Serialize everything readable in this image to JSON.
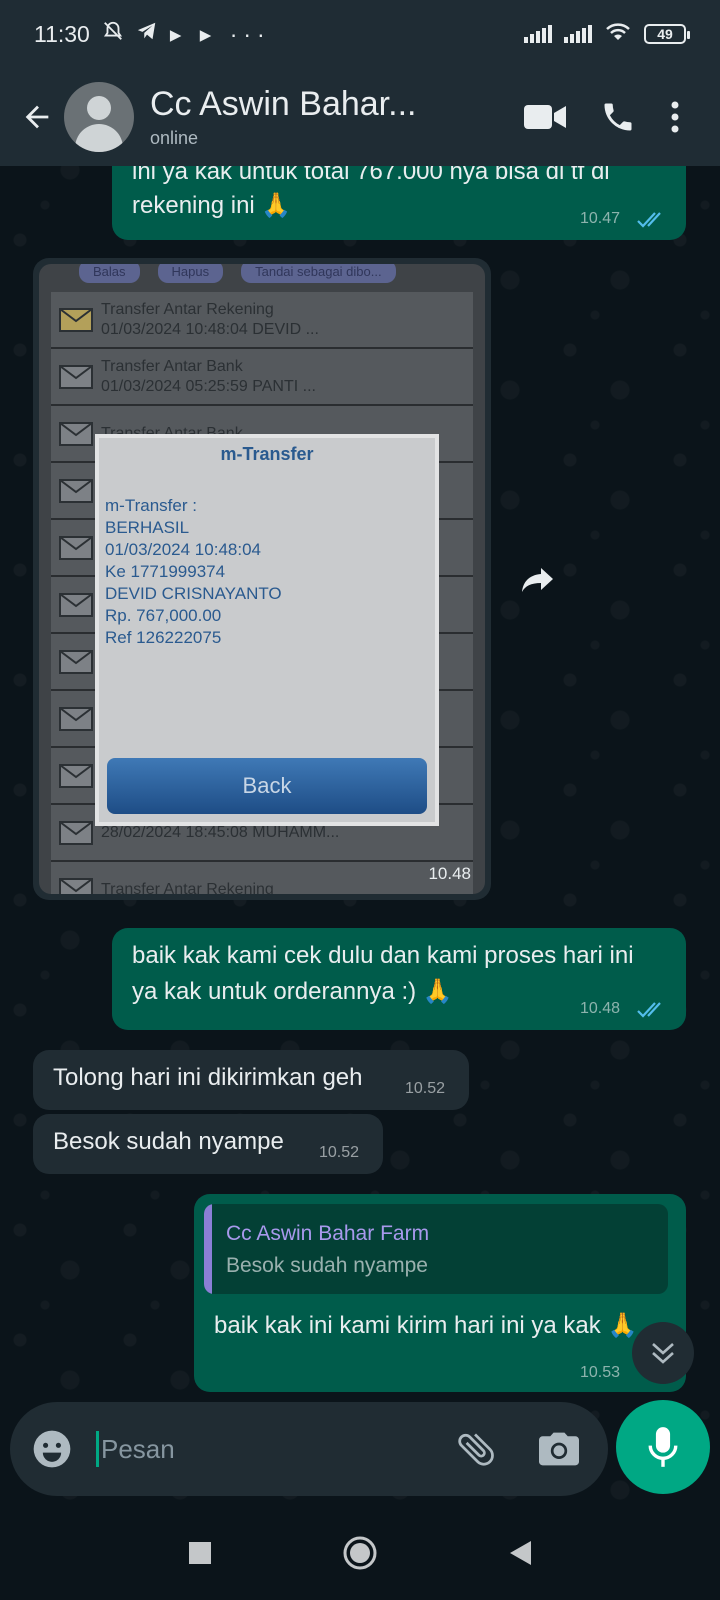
{
  "status_bar": {
    "time": "11:30",
    "extra_icons": "▸ ▸ ···",
    "battery": "49"
  },
  "header": {
    "contact_name": "Cc Aswin Bahar...",
    "contact_status": "online"
  },
  "messages": [
    {
      "type": "text",
      "direction": "outgoing",
      "text": "rekening ini 🙏",
      "partial_text": "ini ya kak untuk total 767.000 nya bisa di tf di",
      "time": "10.47",
      "status": "read"
    },
    {
      "type": "image",
      "direction": "incoming",
      "time": "10.48",
      "image_content": {
        "chips": [
          "Balas",
          "Hapus",
          "Tandai sebagai dibo..."
        ],
        "rows": [
          {
            "title": "Transfer Antar Rekening",
            "subtitle": "01/03/2024 10:48:04 DEVID ..."
          },
          {
            "title": "Transfer Antar Bank",
            "subtitle": "01/03/2024 05:25:59 PANTI ..."
          },
          {
            "title": "Transfer Antar Bank",
            "subtitle": ""
          },
          {
            "title": "",
            "subtitle": ""
          },
          {
            "title": "",
            "subtitle": ""
          },
          {
            "title": "",
            "subtitle": ""
          },
          {
            "title": "",
            "subtitle": ""
          },
          {
            "title": "",
            "subtitle": ""
          },
          {
            "title": "",
            "subtitle": ""
          },
          {
            "title": "",
            "subtitle": "28/02/2024 18:45:08 MUHAMM..."
          },
          {
            "title": "Transfer Antar Rekening",
            "subtitle": ""
          }
        ],
        "dialog": {
          "title": "m-Transfer",
          "lines": [
            "m-Transfer :",
            "BERHASIL",
            "01/03/2024 10:48:04",
            "Ke 1771999374",
            "DEVID CRISNAYANTO",
            "Rp. 767,000.00",
            "Ref 126222075"
          ],
          "back_label": "Back"
        }
      }
    },
    {
      "type": "text",
      "direction": "outgoing",
      "text": "baik kak kami cek dulu dan kami proses hari ini ya kak untuk orderannya :) 🙏",
      "time": "10.48",
      "status": "read"
    },
    {
      "type": "text",
      "direction": "incoming",
      "text": "Tolong hari ini dikirimkan geh",
      "time": "10.52"
    },
    {
      "type": "text",
      "direction": "incoming",
      "text": "Besok sudah nyampe",
      "time": "10.52"
    },
    {
      "type": "reply",
      "direction": "outgoing",
      "quoted_name": "Cc Aswin Bahar Farm",
      "quoted_text": "Besok sudah nyampe",
      "text": "baik kak ini kami kirim hari ini ya kak 🙏",
      "time": "10.53",
      "status": "read"
    }
  ],
  "composer": {
    "placeholder": "Pesan"
  },
  "colors": {
    "outgoing_bubble": "#005c4b",
    "incoming_bubble": "#202c33",
    "accent": "#00a884",
    "read_ticks": "#53bdeb",
    "background": "#0b141a"
  }
}
